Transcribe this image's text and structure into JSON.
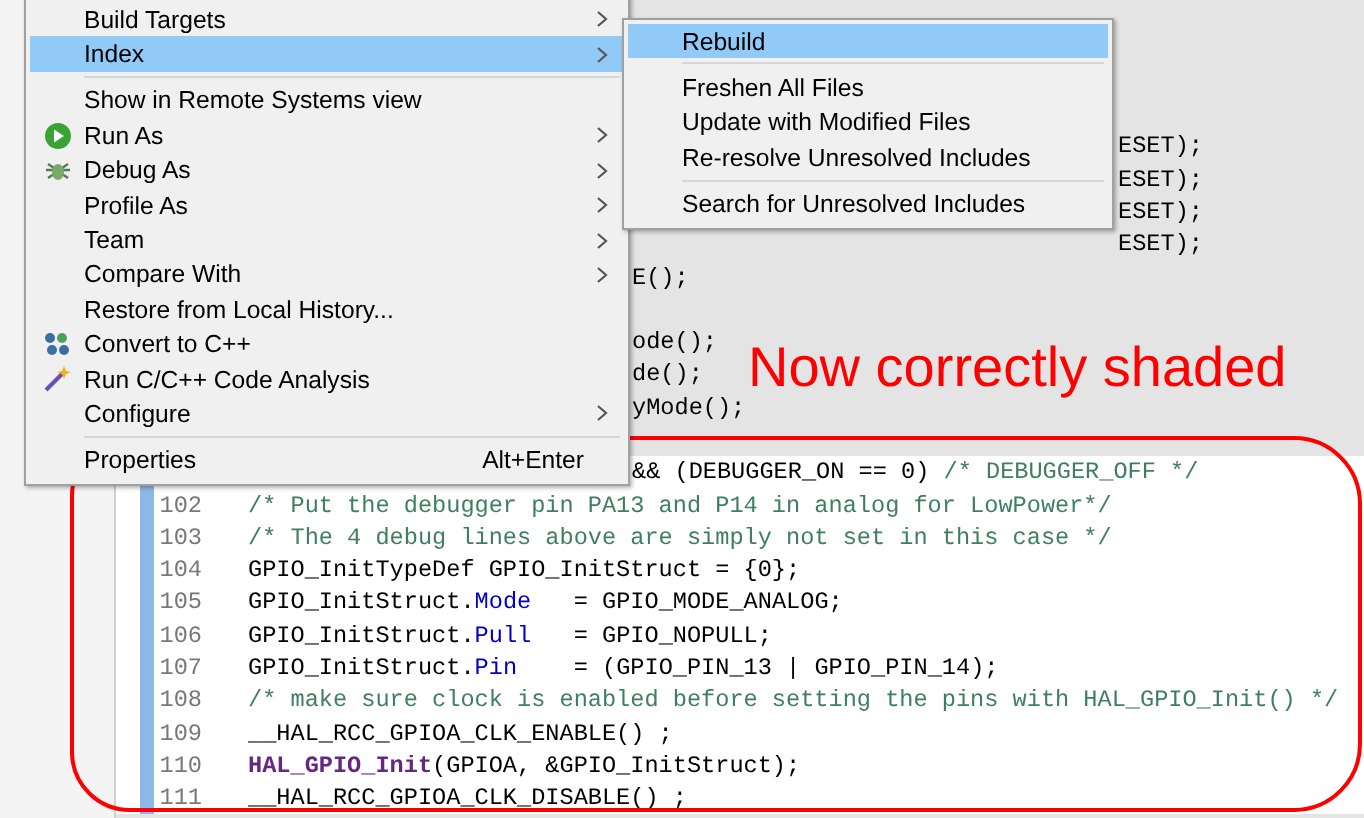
{
  "editor": {
    "rows": [
      {
        "shaded": true,
        "kind": "blank"
      },
      {
        "shaded": true,
        "kind": "blank"
      },
      {
        "shaded": true,
        "kind": "blank"
      },
      {
        "shaded": true,
        "kind": "blank"
      },
      {
        "shaded": true,
        "kind": "behind_submenu",
        "code": [
          {
            "kind": "plain",
            "text": "ESET);"
          }
        ]
      },
      {
        "shaded": true,
        "kind": "behind_submenu",
        "code": [
          {
            "kind": "plain",
            "text": "ESET);"
          }
        ]
      },
      {
        "shaded": true,
        "kind": "behind_submenu",
        "code": [
          {
            "kind": "plain",
            "text": "ESET);"
          }
        ]
      },
      {
        "shaded": true,
        "kind": "behind_submenu",
        "code": [
          {
            "kind": "plain",
            "text": "ESET);"
          }
        ]
      },
      {
        "shaded": true,
        "kind": "behind_menu",
        "code": [
          {
            "kind": "plain",
            "text": "E();"
          }
        ]
      },
      {
        "shaded": true,
        "kind": "blank"
      },
      {
        "shaded": true,
        "kind": "behind_menu",
        "code": [
          {
            "kind": "plain",
            "text": "ode();"
          }
        ]
      },
      {
        "shaded": true,
        "kind": "behind_menu",
        "code": [
          {
            "kind": "plain",
            "text": "de();"
          }
        ]
      },
      {
        "shaded": true,
        "kind": "behind_menu",
        "code": [
          {
            "kind": "plain",
            "text": "yMode();"
          }
        ]
      },
      {
        "shaded": true,
        "kind": "blank"
      },
      {
        "shaded": false,
        "kind": "behind_menu",
        "code": [
          {
            "kind": "plain",
            "text": "&& (DEBUGGER_ON == 0) "
          },
          {
            "kind": "comment",
            "text": "/* DEBUGGER_OFF */"
          }
        ]
      },
      {
        "shaded": false,
        "kind": "full",
        "number": "102",
        "code": [
          {
            "kind": "comment",
            "text": "/* Put the debugger pin PA13 and P14 in analog for LowPower*/"
          }
        ]
      },
      {
        "shaded": false,
        "kind": "full",
        "number": "103",
        "code": [
          {
            "kind": "comment",
            "text": "/* The 4 debug lines above are simply not set in this case */"
          }
        ]
      },
      {
        "shaded": false,
        "kind": "full",
        "number": "104",
        "code": [
          {
            "kind": "plain",
            "text": "GPIO_InitTypeDef GPIO_InitStruct = {0};"
          }
        ]
      },
      {
        "shaded": false,
        "kind": "full",
        "number": "105",
        "code": [
          {
            "kind": "plain",
            "text": "GPIO_InitStruct."
          },
          {
            "kind": "field",
            "text": "Mode"
          },
          {
            "kind": "plain",
            "text": "   = GPIO_MODE_ANALOG;"
          }
        ]
      },
      {
        "shaded": false,
        "kind": "full",
        "number": "106",
        "code": [
          {
            "kind": "plain",
            "text": "GPIO_InitStruct."
          },
          {
            "kind": "field",
            "text": "Pull"
          },
          {
            "kind": "plain",
            "text": "   = GPIO_NOPULL;"
          }
        ]
      },
      {
        "shaded": false,
        "kind": "full",
        "number": "107",
        "code": [
          {
            "kind": "plain",
            "text": "GPIO_InitStruct."
          },
          {
            "kind": "field",
            "text": "Pin"
          },
          {
            "kind": "plain",
            "text": "    = (GPIO_PIN_13 | GPIO_PIN_14);"
          }
        ]
      },
      {
        "shaded": false,
        "kind": "full",
        "number": "108",
        "code": [
          {
            "kind": "comment",
            "text": "/* make sure clock is enabled before setting the pins with HAL_GPIO_Init() */"
          }
        ]
      },
      {
        "shaded": false,
        "kind": "full",
        "number": "109",
        "code": [
          {
            "kind": "plain",
            "text": "__HAL_RCC_GPIOA_CLK_ENABLE() ;"
          }
        ]
      },
      {
        "shaded": false,
        "kind": "full",
        "number": "110",
        "code": [
          {
            "kind": "function",
            "text": "HAL_GPIO_Init"
          },
          {
            "kind": "plain",
            "text": "(GPIOA, &GPIO_InitStruct);"
          }
        ]
      },
      {
        "shaded": false,
        "kind": "full",
        "number": "111",
        "code": [
          {
            "kind": "plain",
            "text": "__HAL_RCC_GPIOA_CLK_DISABLE() ;"
          }
        ]
      }
    ]
  },
  "context_menu": {
    "items": [
      {
        "kind": "item",
        "label": "Build Targets",
        "submenu": true,
        "selected": false
      },
      {
        "kind": "item",
        "label": "Index",
        "submenu": true,
        "selected": true
      },
      {
        "kind": "separator"
      },
      {
        "kind": "item",
        "label": "Show in Remote Systems view",
        "submenu": false,
        "selected": false
      },
      {
        "kind": "run",
        "label": "Run As",
        "submenu": true,
        "selected": false
      },
      {
        "kind": "debug",
        "label": "Debug As",
        "submenu": true,
        "selected": false
      },
      {
        "kind": "item",
        "label": "Profile As",
        "submenu": true,
        "selected": false
      },
      {
        "kind": "item",
        "label": "Team",
        "submenu": true,
        "selected": false
      },
      {
        "kind": "item",
        "label": "Compare With",
        "submenu": true,
        "selected": false
      },
      {
        "kind": "item",
        "label": "Restore from Local History...",
        "submenu": false,
        "selected": false
      },
      {
        "kind": "convert",
        "label": "Convert to C++",
        "submenu": false,
        "selected": false
      },
      {
        "kind": "analysis",
        "label": "Run C/C++ Code Analysis",
        "submenu": false,
        "selected": false
      },
      {
        "kind": "item",
        "label": "Configure",
        "submenu": true,
        "selected": false
      },
      {
        "kind": "separator"
      },
      {
        "kind": "item",
        "label": "Properties",
        "shortcut": "Alt+Enter",
        "submenu": false,
        "selected": false
      }
    ]
  },
  "submenu": {
    "items": [
      {
        "kind": "item",
        "label": "Rebuild",
        "selected": true
      },
      {
        "kind": "separator"
      },
      {
        "kind": "item",
        "label": "Freshen All Files",
        "selected": false
      },
      {
        "kind": "item",
        "label": "Update with Modified Files",
        "selected": false
      },
      {
        "kind": "item",
        "label": "Re-resolve Unresolved Includes",
        "selected": false
      },
      {
        "kind": "separator"
      },
      {
        "kind": "item",
        "label": "Search for Unresolved Includes",
        "selected": false
      }
    ]
  },
  "annotation": {
    "text": "Now correctly shaded"
  }
}
